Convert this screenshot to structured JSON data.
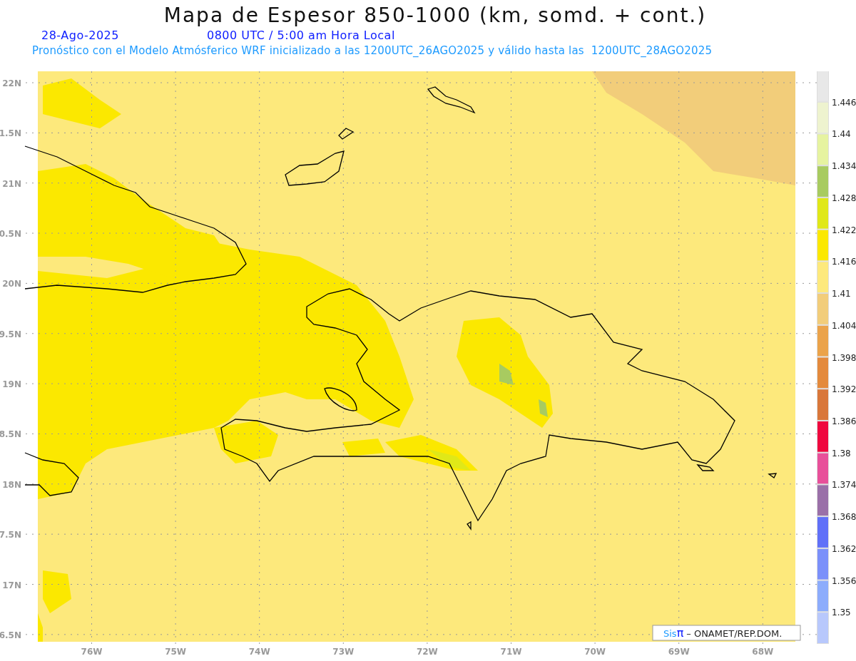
{
  "title": "Mapa de Espesor 850-1000 (km, somd. + cont.)",
  "date": "28-Ago-2025",
  "time": "0800 UTC / 5:00 am Hora Local",
  "forecast": "Pronóstico con el Modelo Atmósferico WRF inicializado a las 1200UTC_26AGO2025 y válido hasta las  1200UTC_28AGO2025",
  "y_ticks": [
    "22N",
    "1.5N",
    "21N",
    "0.5N",
    "20N",
    "9.5N",
    "19N",
    "8.5N",
    "18N",
    "7.5N",
    "17N",
    "6.5N"
  ],
  "x_ticks": [
    "76W",
    "75W",
    "74W",
    "73W",
    "72W",
    "71W",
    "70W",
    "69W",
    "68W"
  ],
  "colorbar": {
    "bands": [
      {
        "color": "#e8e8e8"
      },
      {
        "color": "#eef3cf"
      },
      {
        "color": "#e6f3a0"
      },
      {
        "color": "#a8cb60"
      },
      {
        "color": "#e0e818"
      },
      {
        "color": "#fbe800"
      },
      {
        "color": "#fde97c"
      },
      {
        "color": "#f2cd7a"
      },
      {
        "color": "#eba34a"
      },
      {
        "color": "#e48a3c"
      },
      {
        "color": "#d9773a"
      },
      {
        "color": "#ef073e"
      },
      {
        "color": "#e8509a"
      },
      {
        "color": "#9a70a8"
      },
      {
        "color": "#6070f8"
      },
      {
        "color": "#7b90fa"
      },
      {
        "color": "#8cacfc"
      },
      {
        "color": "#b8c8fc"
      }
    ],
    "labels": [
      "1.446",
      "1.44",
      "1.434",
      "1.428",
      "1.422",
      "1.416",
      "1.41",
      "1.404",
      "1.398",
      "1.392",
      "1.386",
      "1.38",
      "1.374",
      "1.368",
      "1.362",
      "1.356",
      "1.35"
    ]
  },
  "credit": {
    "logo_prefix": "Sis",
    "logo_symbol": "π",
    "text": "– ONAMET/REP.DOM."
  }
}
